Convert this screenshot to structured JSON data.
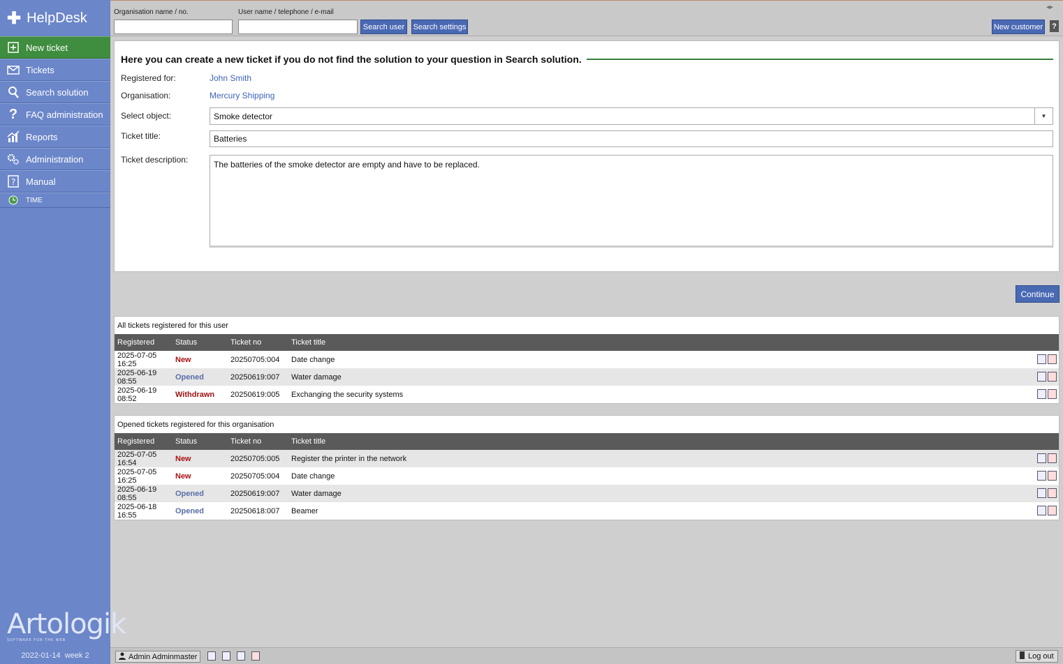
{
  "app": {
    "title": "HelpDesk"
  },
  "sidebar": {
    "items": [
      {
        "label": "New ticket",
        "icon": "plus-square-icon"
      },
      {
        "label": "Tickets",
        "icon": "envelope-icon"
      },
      {
        "label": "Search solution",
        "icon": "magnifier-icon"
      },
      {
        "label": "FAQ administration",
        "icon": "question-icon"
      },
      {
        "label": "Reports",
        "icon": "bar-chart-icon"
      },
      {
        "label": "Administration",
        "icon": "gears-icon"
      },
      {
        "label": "Manual",
        "icon": "manual-icon"
      },
      {
        "label": "TIME",
        "icon": "globe-clock-icon"
      }
    ],
    "brand": "Artologik",
    "brand_tagline": "SOFTWARE FOR THE WEB",
    "date": "2022-01-14  week 2"
  },
  "topbar": {
    "org_label": "Organisation name / no.",
    "org_value": "",
    "user_label": "User name / telephone / e-mail",
    "user_value": "",
    "search_user": "Search user",
    "search_settings": "Search settings",
    "new_customer": "New customer",
    "help": "?"
  },
  "form": {
    "heading": "Here you can create a new ticket if you do not find the solution to your question in Search solution.",
    "registered_for_label": "Registered for:",
    "registered_for_value": "John Smith",
    "organisation_label": "Organisation:",
    "organisation_value": "Mercury Shipping",
    "object_label": "Select object:",
    "object_value": "Smoke detector",
    "title_label": "Ticket title:",
    "title_value": "Batteries",
    "description_label": "Ticket description:",
    "description_value": "The batteries of the smoke detector are empty and have to be replaced.",
    "continue": "Continue"
  },
  "user_tickets": {
    "caption": "All tickets registered for this user",
    "columns": [
      "Registered",
      "Status",
      "Ticket no",
      "Ticket title"
    ],
    "rows": [
      {
        "registered": "2025-07-05 16:25",
        "status": "New",
        "ticket_no": "20250705:004",
        "title": "Date change"
      },
      {
        "registered": "2025-06-19 08:55",
        "status": "Opened",
        "ticket_no": "20250619:007",
        "title": "Water damage"
      },
      {
        "registered": "2025-06-19 08:52",
        "status": "Withdrawn",
        "ticket_no": "20250619:005",
        "title": "Exchanging the security systems"
      }
    ]
  },
  "org_tickets": {
    "caption": "Opened tickets registered for this organisation",
    "columns": [
      "Registered",
      "Status",
      "Ticket no",
      "Ticket title"
    ],
    "rows": [
      {
        "registered": "2025-07-05 16:54",
        "status": "New",
        "ticket_no": "20250705:005",
        "title": "Register the printer in the network"
      },
      {
        "registered": "2025-07-05 16:25",
        "status": "New",
        "ticket_no": "20250705:004",
        "title": "Date change"
      },
      {
        "registered": "2025-06-19 08:55",
        "status": "Opened",
        "ticket_no": "20250619:007",
        "title": "Water damage"
      },
      {
        "registered": "2025-06-18 16:55",
        "status": "Opened",
        "ticket_no": "20250618:007",
        "title": "Beamer"
      }
    ]
  },
  "bottombar": {
    "user": "Admin Adminmaster",
    "logout": "Log out"
  },
  "colors": {
    "sidebar": "#6b86c9",
    "active": "#3f8d3f",
    "button": "#4a69b3",
    "status_new": "#aa1111",
    "status_opened": "#5a6ea8"
  }
}
